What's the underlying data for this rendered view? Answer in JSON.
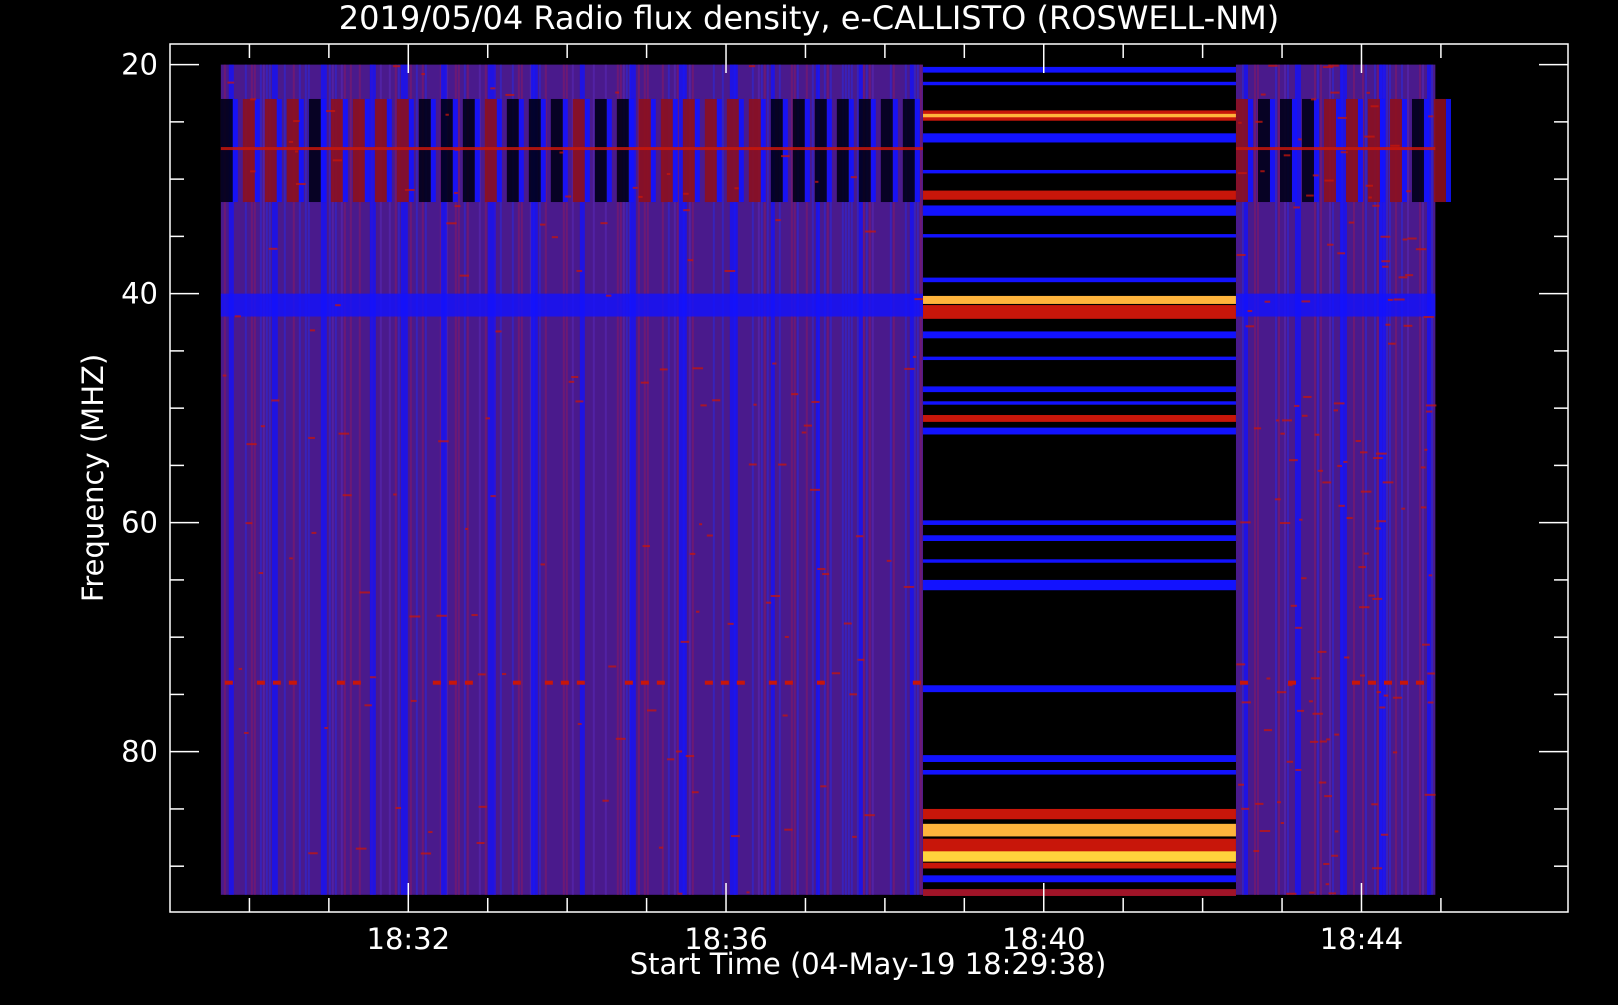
{
  "chart_data": {
    "type": "heatmap",
    "title": "2019/05/04  Radio flux density, e-CALLISTO (ROSWELL-NM)",
    "xlabel": "Start Time (04-May-19 18:29:38)",
    "ylabel": "Frequency (MHZ)",
    "x_ticks": [
      "18:32",
      "18:36",
      "18:40",
      "18:44"
    ],
    "x_tick_minutes": [
      32,
      36,
      40,
      44
    ],
    "x_range_minutes": [
      29.0,
      46.6
    ],
    "y_ticks": [
      "20",
      "40",
      "60",
      "80"
    ],
    "y_tick_values": [
      20,
      40,
      60,
      80
    ],
    "y_range": [
      18.2,
      94.0
    ],
    "y_inverted": true,
    "segments": [
      {
        "start_min": 29.64,
        "end_min": 38.48,
        "style": "normal"
      },
      {
        "start_min": 38.48,
        "end_min": 42.42,
        "style": "calibration"
      },
      {
        "start_min": 42.42,
        "end_min": 44.93,
        "style": "normal"
      }
    ],
    "freq_range": [
      20,
      92.5
    ],
    "colors": {
      "background": "#000000",
      "base": "#4a1a8c",
      "low": "#1212ff",
      "high": "#c8160a",
      "peak": "#ffb43c",
      "axis": "#ffffff"
    },
    "grid": false,
    "legend": "none"
  }
}
